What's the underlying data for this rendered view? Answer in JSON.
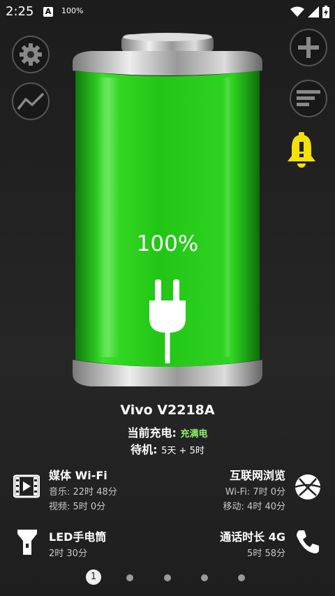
{
  "status_bar": {
    "time": "2:25",
    "notif_letter": "A",
    "battery_text": "100%",
    "icons": [
      "wifi-icon",
      "signal-icon",
      "battery-icon"
    ]
  },
  "battery": {
    "level_percent": 100,
    "percent_label": "100%",
    "fill_color": "#2ecc1a",
    "charging": true
  },
  "device": {
    "name": "Vivo V2218A",
    "charge_label": "当前充电:",
    "charge_status": "充满电",
    "standby_label": "待机:",
    "standby_value": "5天 + 5时"
  },
  "stats": {
    "media": {
      "title": "媒体 Wi-Fi",
      "line1": "音乐: 22时 48分",
      "line2": "视频: 5时 0分",
      "icon": "video-icon"
    },
    "web": {
      "title": "互联网浏览",
      "line1": "Wi-Fi: 7时 0分",
      "line2": "移动: 4时 40分",
      "icon": "globe-icon"
    },
    "led": {
      "title": "LED手电筒",
      "line1": "2时 30分",
      "icon": "flashlight-icon"
    },
    "call": {
      "title": "通话时长 4G",
      "line1": "5时 58分",
      "icon": "phone-icon"
    }
  },
  "pager": {
    "active_label": "1",
    "total": 5,
    "active_index": 0
  },
  "colors": {
    "accent_green": "#8ef06a",
    "bell_yellow": "#f5e100"
  }
}
